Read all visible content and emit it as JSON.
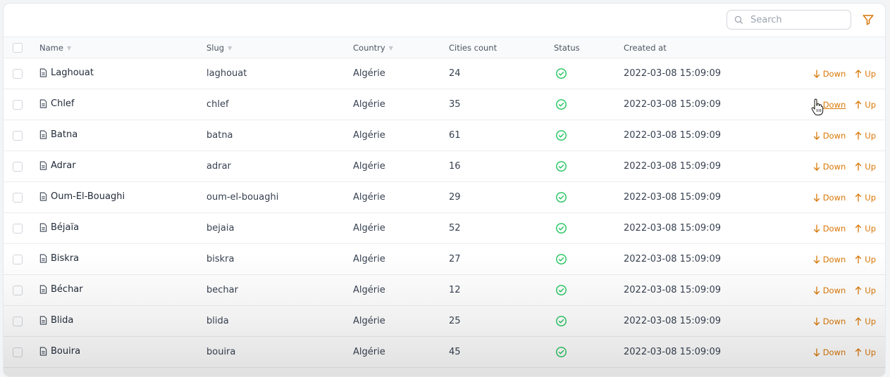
{
  "search": {
    "placeholder": "Search"
  },
  "columns": {
    "name": "Name",
    "slug": "Slug",
    "country": "Country",
    "cities_count": "Cities count",
    "status": "Status",
    "created_at": "Created at"
  },
  "actions": {
    "down_label": "Down",
    "up_label": "Up"
  },
  "colors": {
    "accent": "#d97706",
    "status_ok": "#22c55e"
  },
  "rows": [
    {
      "name": "Laghouat",
      "slug": "laghouat",
      "country": "Algérie",
      "cities_count": "24",
      "status": "active",
      "created_at": "2022-03-08 15:09:09"
    },
    {
      "name": "Chlef",
      "slug": "chlef",
      "country": "Algérie",
      "cities_count": "35",
      "status": "active",
      "created_at": "2022-03-08 15:09:09"
    },
    {
      "name": "Batna",
      "slug": "batna",
      "country": "Algérie",
      "cities_count": "61",
      "status": "active",
      "created_at": "2022-03-08 15:09:09"
    },
    {
      "name": "Adrar",
      "slug": "adrar",
      "country": "Algérie",
      "cities_count": "16",
      "status": "active",
      "created_at": "2022-03-08 15:09:09"
    },
    {
      "name": "Oum-El-Bouaghi",
      "slug": "oum-el-bouaghi",
      "country": "Algérie",
      "cities_count": "29",
      "status": "active",
      "created_at": "2022-03-08 15:09:09"
    },
    {
      "name": "Béjaïa",
      "slug": "bejaia",
      "country": "Algérie",
      "cities_count": "52",
      "status": "active",
      "created_at": "2022-03-08 15:09:09"
    },
    {
      "name": "Biskra",
      "slug": "biskra",
      "country": "Algérie",
      "cities_count": "27",
      "status": "active",
      "created_at": "2022-03-08 15:09:09"
    },
    {
      "name": "Béchar",
      "slug": "bechar",
      "country": "Algérie",
      "cities_count": "12",
      "status": "active",
      "created_at": "2022-03-08 15:09:09"
    },
    {
      "name": "Blida",
      "slug": "blida",
      "country": "Algérie",
      "cities_count": "25",
      "status": "active",
      "created_at": "2022-03-08 15:09:09"
    },
    {
      "name": "Bouira",
      "slug": "bouira",
      "country": "Algérie",
      "cities_count": "45",
      "status": "active",
      "created_at": "2022-03-08 15:09:09"
    }
  ]
}
